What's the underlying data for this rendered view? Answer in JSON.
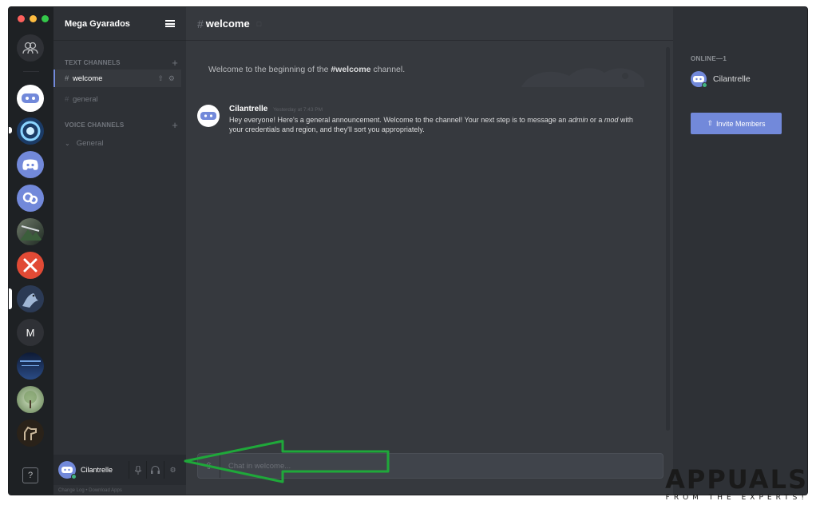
{
  "servers": [
    {
      "name": "friends",
      "icon": "friends-icon",
      "color": "#2f3136"
    },
    {
      "name": "server-discord-blue",
      "icon": "discord-logo-icon",
      "color": "#ffffff"
    },
    {
      "name": "server-overwatch",
      "icon": "overwatch-icon",
      "color": "#1b3b66"
    },
    {
      "name": "server-discord",
      "icon": "discord-logo-icon",
      "color": "#7289da"
    },
    {
      "name": "server-gears",
      "icon": "gears-icon",
      "color": "#7289da"
    },
    {
      "name": "server-game",
      "icon": "game-art-icon",
      "color": "#2a3a2a"
    },
    {
      "name": "server-tools",
      "icon": "hammer-icon",
      "color": "#e14a35"
    },
    {
      "name": "server-dragon",
      "icon": "dragon-icon",
      "color": "#2b3a55"
    },
    {
      "name": "server-m",
      "label": "M",
      "color": "#2f3136"
    },
    {
      "name": "server-space",
      "icon": "space-icon",
      "color": "#1a2f55"
    },
    {
      "name": "server-tree",
      "icon": "tree-icon",
      "color": "#8fa87a"
    },
    {
      "name": "server-horse",
      "icon": "horse-icon",
      "color": "#2a2219"
    }
  ],
  "help": "?",
  "guild": {
    "name": "Mega Gyarados"
  },
  "categories": {
    "text": "TEXT CHANNELS",
    "voice": "VOICE CHANNELS"
  },
  "channels": {
    "text": [
      {
        "name": "welcome",
        "active": true
      },
      {
        "name": "general",
        "active": false
      }
    ],
    "voice": [
      {
        "name": "General"
      }
    ]
  },
  "user": {
    "name": "Cilantrelle",
    "status_color": "#43b581"
  },
  "footer": {
    "changelog": "Change Log",
    "sep": "•",
    "download": "Download Apps"
  },
  "chat": {
    "channel": "welcome",
    "hash": "#",
    "welcome_prefix": "Welcome to the beginning of the ",
    "welcome_channel": "#welcome",
    "welcome_suffix": " channel.",
    "message": {
      "author": "Cilantrelle",
      "time": "Yesterday at 7:43 PM",
      "text_1": "Hey everyone! Here's a general announcement. Welcome to the channel! Your next step is to message an ",
      "em_1": "admin",
      "text_2": " or a ",
      "em_2": "mod",
      "text_3": " with your credentials and region, and they'll sort you appropriately."
    },
    "placeholder": "Chat in welcome..."
  },
  "members": {
    "online_header": "ONLINE—1",
    "list": [
      {
        "name": "Cilantrelle"
      }
    ],
    "invite_label": "Invite Members"
  },
  "watermark": {
    "big": "APPUALS",
    "small": "FROM THE EXPERTS!"
  },
  "colors": {
    "accent": "#7289da",
    "online": "#43b581",
    "arrow": "#1fa83a"
  }
}
